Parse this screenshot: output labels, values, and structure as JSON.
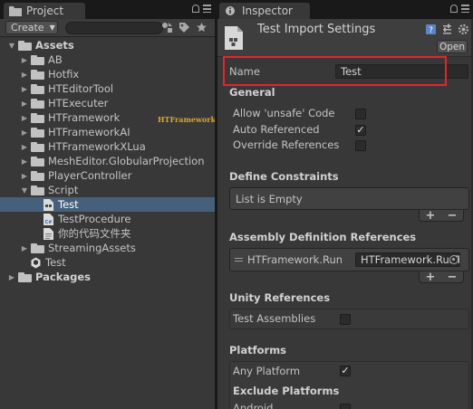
{
  "project": {
    "tab_label": "Project",
    "create_label": "Create",
    "tree": [
      {
        "label": "Assets",
        "depth": 0,
        "expanded": true,
        "icon": "folder-icon",
        "root": true
      },
      {
        "label": "AB",
        "depth": 1,
        "icon": "folder-icon"
      },
      {
        "label": "Hotfix",
        "depth": 1,
        "icon": "folder-icon"
      },
      {
        "label": "HTEditorTool",
        "depth": 1,
        "icon": "folder-icon"
      },
      {
        "label": "HTExecuter",
        "depth": 1,
        "icon": "folder-icon"
      },
      {
        "label": "HTFramework",
        "depth": 1,
        "icon": "folder-icon"
      },
      {
        "label": "HTFrameworkAI",
        "depth": 1,
        "icon": "folder-icon"
      },
      {
        "label": "HTFrameworkXLua",
        "depth": 1,
        "icon": "folder-icon"
      },
      {
        "label": "MeshEditor.GlobularProjection",
        "depth": 1,
        "icon": "folder-icon"
      },
      {
        "label": "PlayerController",
        "depth": 1,
        "icon": "folder-icon"
      },
      {
        "label": "Script",
        "depth": 1,
        "expanded": true,
        "icon": "folder-icon"
      },
      {
        "label": "Test",
        "depth": 2,
        "icon": "assembly-definition-icon",
        "selected": true
      },
      {
        "label": "TestProcedure",
        "depth": 2,
        "icon": "csharp-script-icon"
      },
      {
        "label": "你的代码文件夹",
        "depth": 2,
        "icon": "text-asset-icon"
      },
      {
        "label": "StreamingAssets",
        "depth": 1,
        "icon": "folder-icon"
      },
      {
        "label": "Test",
        "depth": 1,
        "icon": "unity-scene-icon"
      },
      {
        "label": "Packages",
        "depth": 0,
        "icon": "folder-icon",
        "root": true
      }
    ],
    "logo_text": "HTFramework"
  },
  "inspector": {
    "tab_label": "Inspector",
    "title": "Test Import Settings",
    "open_label": "Open",
    "name_label": "Name",
    "name_value": "Test",
    "general": {
      "title": "General",
      "fields": [
        {
          "label": "Allow 'unsafe' Code",
          "checked": false
        },
        {
          "label": "Auto Referenced",
          "checked": true
        },
        {
          "label": "Override References",
          "checked": false
        }
      ]
    },
    "define_constraints": {
      "title": "Define Constraints",
      "empty_text": "List is Empty"
    },
    "assembly_refs": {
      "title": "Assembly Definition References",
      "item_name": "HTFramework.RunTime",
      "item_object": "HTFramework.RunTime"
    },
    "unity_refs": {
      "title": "Unity References",
      "fields": [
        {
          "label": "Test Assemblies",
          "checked": false
        }
      ]
    },
    "platforms": {
      "title": "Platforms",
      "any_platform_label": "Any Platform",
      "any_platform_checked": true,
      "exclude_title": "Exclude Platforms",
      "exclude_first": "Android"
    },
    "list_add": "+",
    "list_remove": "−",
    "check_mark": "✓"
  },
  "colors": {
    "selection": "#46607c",
    "highlight_box": "#e8232b",
    "panel_bg": "#383838",
    "window_bg": "#191919"
  }
}
